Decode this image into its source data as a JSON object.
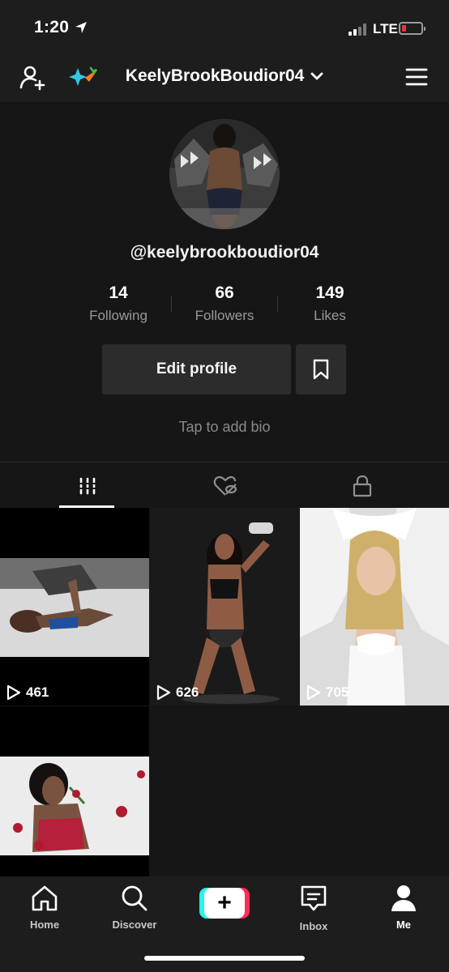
{
  "status_bar": {
    "time": "1:20",
    "network": "LTE",
    "colors": {
      "battery_low": "#e8343b"
    }
  },
  "header": {
    "username": "KeelyBrookBoudior04"
  },
  "profile": {
    "handle": "@keelybrookboudior04",
    "stats": [
      {
        "value": "14",
        "label": "Following"
      },
      {
        "value": "66",
        "label": "Followers"
      },
      {
        "value": "149",
        "label": "Likes"
      }
    ],
    "edit_profile_label": "Edit profile",
    "bio_placeholder": "Tap to add bio"
  },
  "tabs": [
    {
      "name": "videos",
      "icon": "grid-icon",
      "active": true
    },
    {
      "name": "liked",
      "icon": "liked-hidden-icon",
      "active": false
    },
    {
      "name": "private",
      "icon": "lock-icon",
      "active": false
    }
  ],
  "videos": [
    {
      "views": "461"
    },
    {
      "views": "626"
    },
    {
      "views": "705"
    },
    {
      "views": ""
    }
  ],
  "nav": {
    "home": "Home",
    "discover": "Discover",
    "create": "+",
    "inbox": "Inbox",
    "me": "Me"
  },
  "colors": {
    "create_left": "#25f4ee",
    "create_right": "#fe2c55",
    "background": "#161616"
  }
}
